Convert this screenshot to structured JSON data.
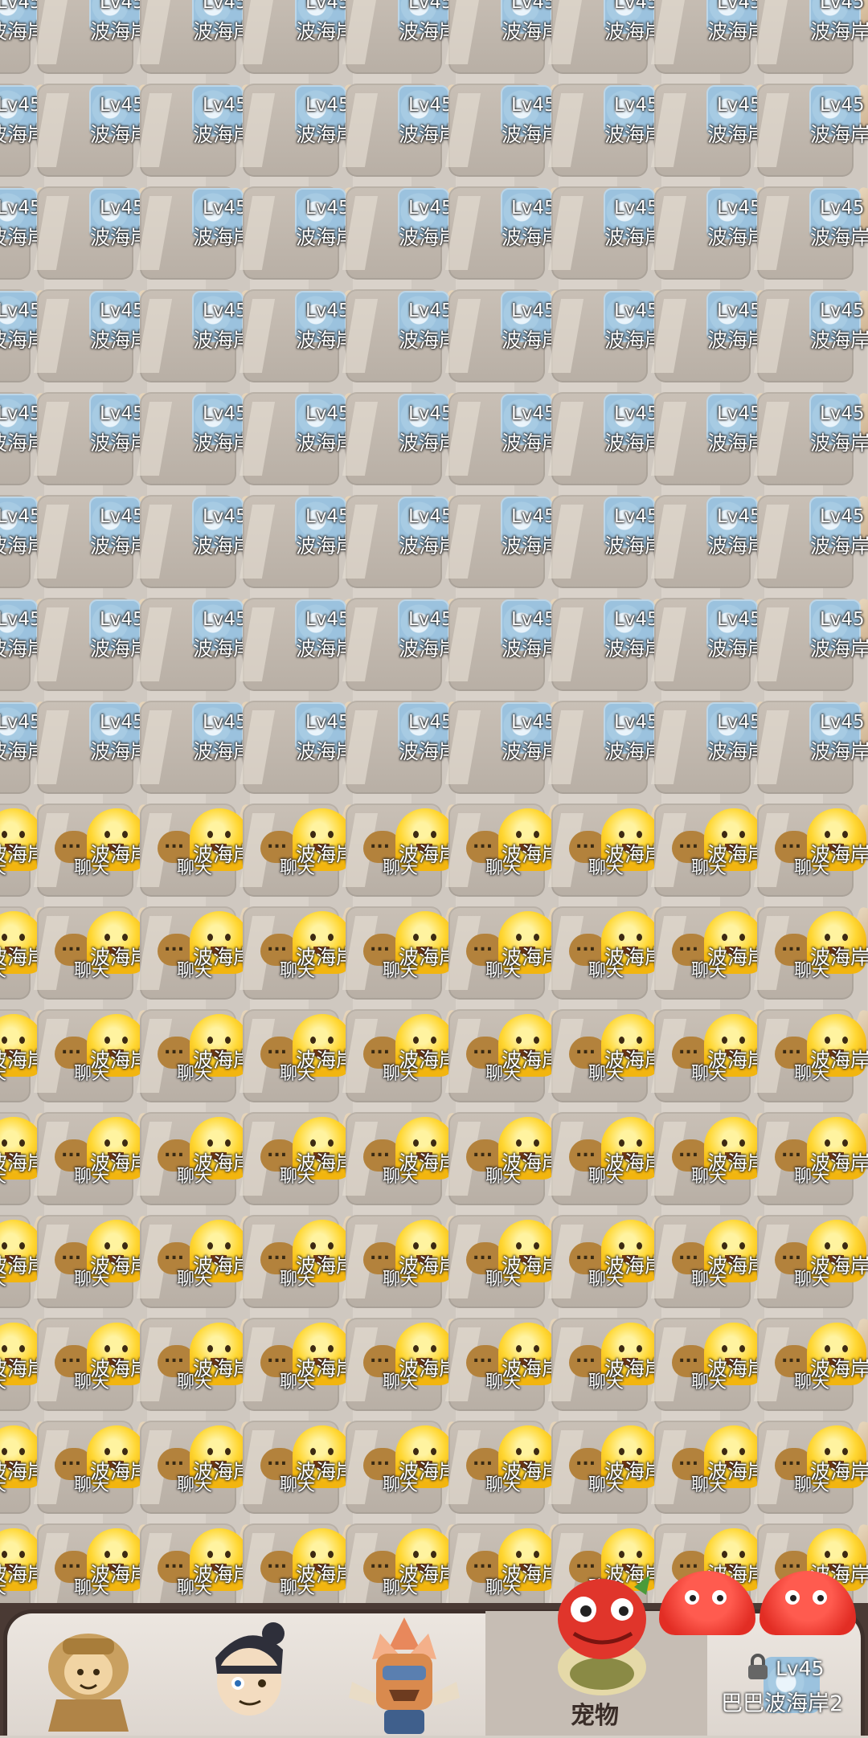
{
  "tile_text": {
    "level": "Lv45",
    "map_name": "波海岸2",
    "chat": "聊天",
    "edge_name_fragment": "岸2"
  },
  "grid": {
    "map_rows": 8,
    "chat_rows": 8,
    "columns": 8
  },
  "bottom_nav": {
    "items": [
      {
        "id": "char1",
        "icon": "lion-hero-icon"
      },
      {
        "id": "char2",
        "icon": "ninja-hero-icon"
      },
      {
        "id": "char3",
        "icon": "tiki-warrior-icon"
      },
      {
        "id": "pet",
        "label": "宠物",
        "icon": "red-pet-icon",
        "active": true
      },
      {
        "id": "locked-map",
        "level": "Lv45",
        "name": "巴巴波海岸2",
        "icon": "lock-icon"
      }
    ]
  },
  "colors": {
    "background": "#d6cfc7",
    "bar_border": "#3e302b",
    "ghost_yellow": "#ffd733",
    "map_blue": "#a7cbe3"
  }
}
